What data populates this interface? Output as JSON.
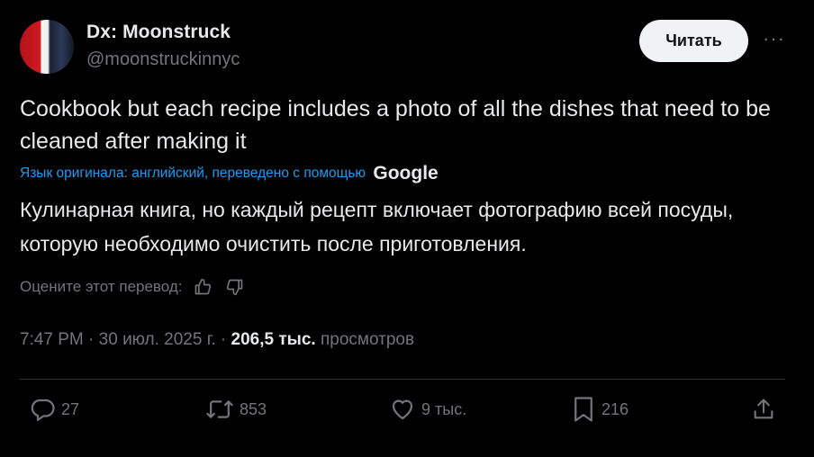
{
  "author": {
    "display_name": "Dx: Moonstruck",
    "handle": "@moonstruckinnyc"
  },
  "follow_button_label": "Читать",
  "more_label": "···",
  "tweet": {
    "text": "Cookbook but each recipe includes a photo of all the dishes that need to be cleaned after making it",
    "translation_note": "Язык оригинала: английский, переведено с помощью",
    "translation_provider": "Google",
    "translated_text": "Кулинарная книга, но каждый рецепт включает фотографию всей посуды, которую необходимо очистить после приготовления.",
    "rate_translation_label": "Оцените этот перевод:"
  },
  "meta": {
    "time": "7:47 PM",
    "sep": "·",
    "date": "30 июл. 2025 г.",
    "views_count": "206,5 тыс.",
    "views_label": "просмотров"
  },
  "actions": {
    "replies": "27",
    "reposts": "853",
    "likes": "9 тыс.",
    "bookmarks": "216"
  },
  "icons": [
    "reply-icon",
    "repost-icon",
    "like-icon",
    "bookmark-icon",
    "share-icon",
    "thumb-up-icon",
    "thumb-down-icon",
    "more-icon"
  ],
  "colors": {
    "background": "#000000",
    "text": "#e7e9ea",
    "secondary": "#71767b",
    "link": "#1d9bf0",
    "button_bg": "#eff3f4",
    "divider": "#2f3336"
  }
}
